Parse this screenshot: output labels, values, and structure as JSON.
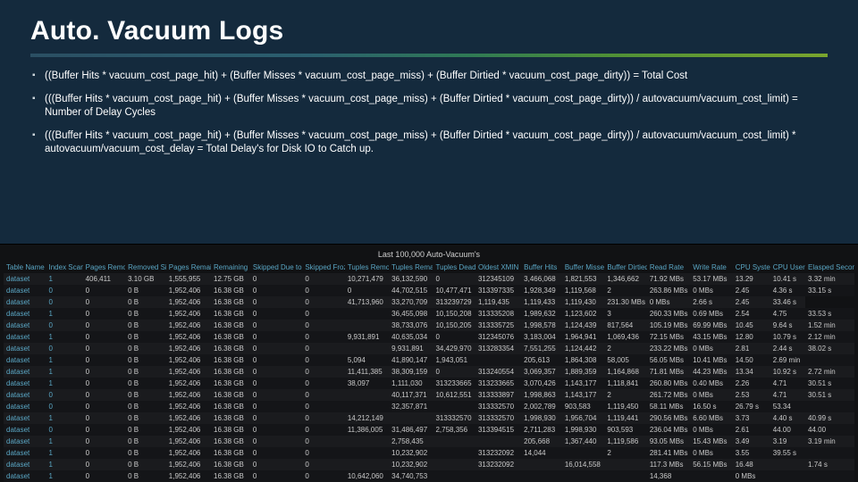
{
  "title": "Auto. Vacuum Logs",
  "bullets": [
    "((Buffer Hits * vacuum_cost_page_hit) + (Buffer Misses * vacuum_cost_page_miss) + (Buffer Dirtied * vacuum_cost_page_dirty)) = Total Cost",
    "(((Buffer Hits * vacuum_cost_page_hit) + (Buffer Misses * vacuum_cost_page_miss) + (Buffer Dirtied * vacuum_cost_page_dirty)) / autovacuum/vacuum_cost_limit) = Number of Delay Cycles",
    "(((Buffer Hits * vacuum_cost_page_hit) + (Buffer Misses * vacuum_cost_page_miss) + (Buffer Dirtied * vacuum_cost_page_dirty)) / autovacuum/vacuum_cost_limit) * autovacuum/vacuum_cost_delay = Total Delay's for Disk IO to Catch up."
  ],
  "table": {
    "caption": "Last 100,000 Auto-Vacuum's",
    "columns": [
      "Table Name",
      "Index Scans",
      "Pages Removed",
      "Removed Size",
      "Pages Remain",
      "Remaining Size",
      "Skipped Due to Pins",
      "Skipped Frozen",
      "Tuples Removed",
      "Tuples Remain",
      "Tuples Dead",
      "Oldest XMIN",
      "Buffer Hits",
      "Buffer Misses",
      "Buffer Dirtied",
      "Read Rate",
      "Write Rate",
      "CPU System",
      "CPU User",
      "Elasped Seconds"
    ],
    "rows": [
      [
        "dataset",
        "1",
        "406,411",
        "3.10 GB",
        "1,555,955",
        "12.75 GB",
        "0",
        "0",
        "10,271,479",
        "36,132,590",
        "0",
        "312345109",
        "3,466,068",
        "1,821,553",
        "1,346,662",
        "71.92 MBs",
        "53.17 MBs",
        "13.29",
        "10.41 s",
        "3.32 min"
      ],
      [
        "dataset",
        "0",
        "0",
        "0 B",
        "1,952,406",
        "16.38 GB",
        "0",
        "0",
        "0",
        "44,702,515",
        "10,477,471",
        "313397335",
        "1,928,349",
        "1,119,568",
        "2",
        "263.86 MBs",
        "0 MBs",
        "2.45",
        "4.36 s",
        "33.15 s"
      ],
      [
        "dataset",
        "0",
        "0",
        "0 B",
        "1,952,406",
        "16.38 GB",
        "0",
        "0",
        "41,713,960",
        "33,270,709",
        "313239729",
        "1,119,435",
        "1,119,433",
        "1,119,430",
        "231.30 MBs",
        "0 MBs",
        "2.66 s",
        "2.45",
        "33.46 s"
      ],
      [
        "dataset",
        "1",
        "0",
        "0 B",
        "1,952,406",
        "16.38 GB",
        "0",
        "0",
        "",
        "36,455,098",
        "10,150,208",
        "313335208",
        "1,989,632",
        "1,123,602",
        "3",
        "260.33 MBs",
        "0.69 MBs",
        "2.54",
        "4.75",
        "33.53 s"
      ],
      [
        "dataset",
        "0",
        "0",
        "0 B",
        "1,952,406",
        "16.38 GB",
        "0",
        "0",
        "",
        "38,733,076",
        "10,150,205",
        "313335725",
        "1,998,578",
        "1,124,439",
        "817,564",
        "105.19 MBs",
        "69.99 MBs",
        "10.45",
        "9.64 s",
        "1.52 min"
      ],
      [
        "dataset",
        "1",
        "0",
        "0 B",
        "1,952,406",
        "16.38 GB",
        "0",
        "0",
        "9,931,891",
        "40,635,034",
        "0",
        "312345076",
        "3,183,004",
        "1,964,941",
        "1,069,436",
        "72.15 MBs",
        "43.15 MBs",
        "12.80",
        "10.79 s",
        "2.12 min"
      ],
      [
        "dataset",
        "0",
        "0",
        "0 B",
        "1,952,406",
        "16.38 GB",
        "0",
        "0",
        "",
        "9,931,891",
        "34,429,970",
        "313283354",
        "7,551,255",
        "1,124,442",
        "2",
        "233.22 MBs",
        "0 MBs",
        "2.81",
        "2.44 s",
        "38.02 s"
      ],
      [
        "dataset",
        "1",
        "0",
        "0 B",
        "1,952,406",
        "16.38 GB",
        "0",
        "0",
        "5,094",
        "41,890,147",
        "1,943,051",
        "",
        "205,613",
        "1,864,308",
        "58,005",
        "56.05 MBs",
        "10.41 MBs",
        "14.50",
        "2.69 min",
        ""
      ],
      [
        "dataset",
        "1",
        "0",
        "0 B",
        "1,952,406",
        "16.38 GB",
        "0",
        "0",
        "11,411,385",
        "38,309,159",
        "0",
        "313240554",
        "3,069,357",
        "1,889,359",
        "1,164,868",
        "71.81 MBs",
        "44.23 MBs",
        "13.34",
        "10.92 s",
        "2.72 min"
      ],
      [
        "dataset",
        "1",
        "0",
        "0 B",
        "1,952,406",
        "16.38 GB",
        "0",
        "0",
        "38,097",
        "1,111,030",
        "313233665",
        "313233665",
        "3,070,426",
        "1,143,177",
        "1,118,841",
        "260.80 MBs",
        "0.40 MBs",
        "2.26",
        "4.71",
        "30.51 s"
      ],
      [
        "dataset",
        "0",
        "0",
        "0 B",
        "1,952,406",
        "16.38 GB",
        "0",
        "0",
        "",
        "40,117,371",
        "10,612,551",
        "313333897",
        "1,998,863",
        "1,143,177",
        "2",
        "261.72 MBs",
        "0 MBs",
        "2.53",
        "4.71",
        "30.51 s"
      ],
      [
        "dataset",
        "0",
        "0",
        "0 B",
        "1,952,406",
        "16.38 GB",
        "0",
        "0",
        "",
        "32,357,871",
        "",
        "313332570",
        "2,002,789",
        "903,583",
        "1,119,450",
        "58.11 MBs",
        "16.50 s",
        "26.79 s",
        "53.34",
        ""
      ],
      [
        "dataset",
        "1",
        "0",
        "0 B",
        "1,952,406",
        "16.38 GB",
        "0",
        "0",
        "14,212,149",
        "",
        "313332570",
        "313332570",
        "1,998,930",
        "1,956,704",
        "1,119,441",
        "290.56 MBs",
        "6.60 MBs",
        "3.73",
        "4.40 s",
        "40.99 s"
      ],
      [
        "dataset",
        "0",
        "0",
        "0 B",
        "1,952,406",
        "16.38 GB",
        "0",
        "0",
        "11,386,005",
        "31,486,497",
        "2,758,356",
        "313394515",
        "2,711,283",
        "1,998,930",
        "903,593",
        "236.04 MBs",
        "0 MBs",
        "2.61",
        "44.00",
        "44.00"
      ],
      [
        "dataset",
        "1",
        "0",
        "0 B",
        "1,952,406",
        "16.38 GB",
        "0",
        "0",
        "",
        "2,758,435",
        "",
        "",
        "205,668",
        "1,367,440",
        "1,119,586",
        "93.05 MBs",
        "15.43 MBs",
        "3.49",
        "3.19",
        "3.19 min"
      ],
      [
        "dataset",
        "1",
        "0",
        "0 B",
        "1,952,406",
        "16.38 GB",
        "0",
        "0",
        "",
        "10,232,902",
        "",
        "313232092",
        "14,044",
        "",
        "2",
        "281.41 MBs",
        "0 MBs",
        "3.55",
        "39.55 s",
        ""
      ],
      [
        "dataset",
        "1",
        "0",
        "0 B",
        "1,952,406",
        "16.38 GB",
        "0",
        "0",
        "",
        "10,232,902",
        "",
        "313232092",
        "",
        "16,014,558",
        "",
        "117.3 MBs",
        "56.15 MBs",
        "16.48",
        "",
        "1.74 s"
      ],
      [
        "dataset",
        "1",
        "0",
        "0 B",
        "1,952,406",
        "16.38 GB",
        "0",
        "0",
        "10,642,060",
        "34,740,753",
        "",
        "",
        "",
        "",
        "",
        "14,368",
        "",
        "0 MBs",
        "",
        ""
      ]
    ]
  }
}
